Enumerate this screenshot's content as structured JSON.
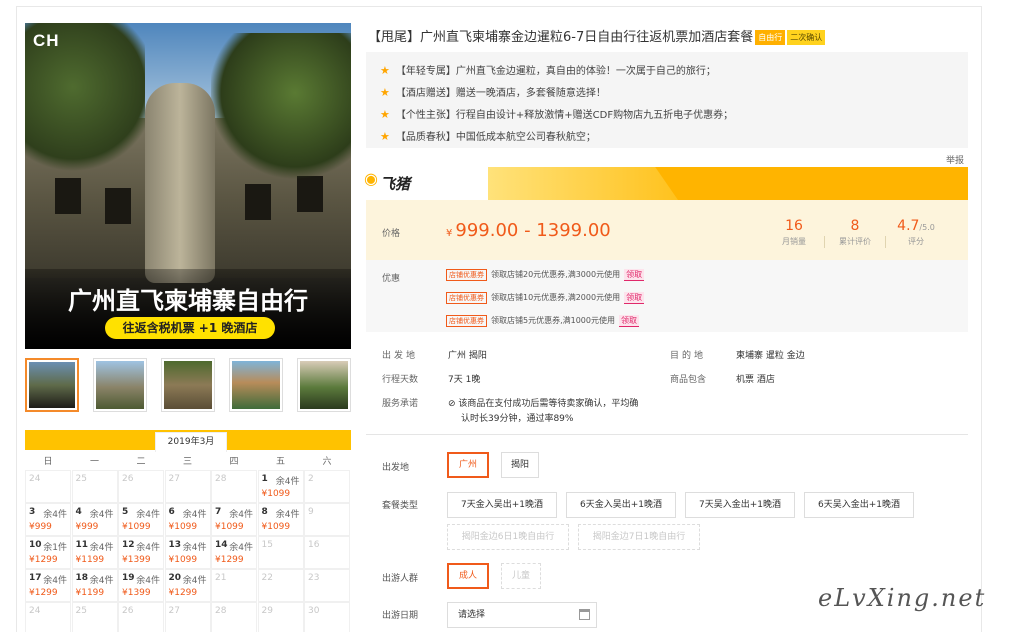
{
  "hero": {
    "logo": "CH",
    "overlay_title": "广州直飞柬埔寨自由行",
    "overlay_pill": "往返含税机票 +1 晚酒店"
  },
  "calendar": {
    "month": "2019年3月",
    "weekdays": [
      "日",
      "一",
      "二",
      "三",
      "四",
      "五",
      "六"
    ],
    "rows": [
      [
        {
          "d": "24",
          "m": true
        },
        {
          "d": "25",
          "m": true
        },
        {
          "d": "26",
          "m": true
        },
        {
          "d": "27",
          "m": true
        },
        {
          "d": "28",
          "m": true
        },
        {
          "d": "1",
          "s": "余4件",
          "p": "¥1099"
        },
        {
          "d": "2",
          "m": true
        }
      ],
      [
        {
          "d": "3",
          "s": "余4件",
          "p": "¥999"
        },
        {
          "d": "4",
          "s": "余4件",
          "p": "¥999"
        },
        {
          "d": "5",
          "s": "余4件",
          "p": "¥1099"
        },
        {
          "d": "6",
          "s": "余4件",
          "p": "¥1099"
        },
        {
          "d": "7",
          "s": "余4件",
          "p": "¥1099"
        },
        {
          "d": "8",
          "s": "余4件",
          "p": "¥1099"
        },
        {
          "d": "9",
          "m": true
        }
      ],
      [
        {
          "d": "10",
          "s": "余1件",
          "p": "¥1299"
        },
        {
          "d": "11",
          "s": "余4件",
          "p": "¥1199"
        },
        {
          "d": "12",
          "s": "余4件",
          "p": "¥1399"
        },
        {
          "d": "13",
          "s": "余4件",
          "p": "¥1099"
        },
        {
          "d": "14",
          "s": "余4件",
          "p": "¥1299"
        },
        {
          "d": "15",
          "m": true
        },
        {
          "d": "16",
          "m": true
        }
      ],
      [
        {
          "d": "17",
          "s": "余4件",
          "p": "¥1299"
        },
        {
          "d": "18",
          "s": "余4件",
          "p": "¥1199"
        },
        {
          "d": "19",
          "s": "余4件",
          "p": "¥1399"
        },
        {
          "d": "20",
          "s": "余4件",
          "p": "¥1299"
        },
        {
          "d": "21",
          "m": true
        },
        {
          "d": "22",
          "m": true
        },
        {
          "d": "23",
          "m": true
        }
      ],
      [
        {
          "d": "24",
          "m": true
        },
        {
          "d": "25",
          "m": true
        },
        {
          "d": "26",
          "m": true
        },
        {
          "d": "27",
          "m": true
        },
        {
          "d": "28",
          "m": true
        },
        {
          "d": "29",
          "m": true
        },
        {
          "d": "30",
          "m": true
        }
      ]
    ]
  },
  "product": {
    "title": "【甩尾】广州直飞柬埔寨金边暹粒6-7日自由行往返机票加酒店套餐",
    "tag_a": "自由行",
    "tag_b": "二次确认",
    "features": [
      "【年轻专属】广州直飞金边暹粒，真自由的体验！一次属于自己的旅行；",
      "【酒店赠送】赠送一晚酒店，多套餐随意选择！",
      "【个性主张】行程自由设计+释放激情+赠送CDF购物店九五折电子优惠券；",
      "【品质春秋】中国低成本航空公司春秋航空；"
    ],
    "report": "举报",
    "brand": "飞猪",
    "price_label": "价格",
    "price_currency": "¥",
    "price": "999.00 - 1399.00",
    "stats": [
      {
        "n": "16",
        "t": "月销量"
      },
      {
        "n": "8",
        "t": "累计评价"
      },
      {
        "n": "4.7",
        "u": "/5.0",
        "t": "评分"
      }
    ],
    "promo_label": "优惠",
    "coupons": [
      {
        "tag": "店铺优惠券",
        "text": "领取店铺20元优惠券,满3000元使用",
        "get": "领取"
      },
      {
        "tag": "店铺优惠券",
        "text": "领取店铺10元优惠券,满2000元使用",
        "get": "领取"
      },
      {
        "tag": "店铺优惠券",
        "text": "领取店铺5元优惠券,满1000元使用",
        "get": "领取"
      }
    ]
  },
  "info": {
    "depart_k": "出发地",
    "depart_v": "广州  揭阳",
    "dest_k": "目的地",
    "dest_v": "柬埔寨  暹粒  金边",
    "days_k": "行程天数",
    "days_v": "7天  1晚",
    "incl_k": "商品包含",
    "incl_v": "机票  酒店",
    "promise_k": "服务承诺",
    "promise_v1": "该商品在支付成功后需等待卖家确认，平均确",
    "promise_v2": "认时长39分钟，通过率89%"
  },
  "options": {
    "depart_label": "出发地",
    "depart": [
      "广州",
      "揭阳"
    ],
    "package_label": "套餐类型",
    "packages_row1": [
      "7天金入吴出+1晚酒",
      "6天金入吴出+1晚酒",
      "7天吴入金出+1晚酒",
      "6天吴入金出+1晚酒"
    ],
    "packages_row2": [
      "揭阳金边6日1晚自由行",
      "揭阳金边7日1晚自由行"
    ],
    "people_label": "出游人群",
    "people": [
      "成人",
      "儿童"
    ],
    "date_label": "出游日期",
    "date_placeholder": "请选择"
  },
  "watermark": "eLvXing.net"
}
